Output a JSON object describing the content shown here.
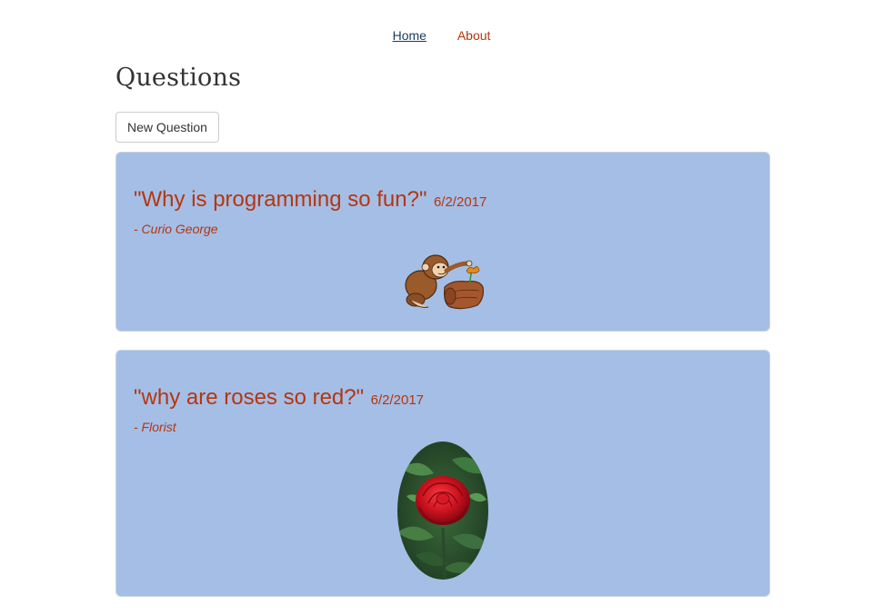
{
  "nav": {
    "links": [
      {
        "label": "Home",
        "active": true
      },
      {
        "label": "About",
        "active": false
      }
    ]
  },
  "page": {
    "title": "Questions",
    "new_question_label": "New Question"
  },
  "questions": [
    {
      "title": "\"Why is programming so fun?\"",
      "date": "6/2/2017",
      "author": "- Curio George",
      "image": "monkey-cartoon-image"
    },
    {
      "title": "\"why are roses so red?\"",
      "date": "6/2/2017",
      "author": "- Florist",
      "image": "red-rose-image"
    }
  ],
  "colors": {
    "accent": "#b5360f",
    "card_background": "#a5bee6",
    "nav_active": "#1d3a5c"
  }
}
